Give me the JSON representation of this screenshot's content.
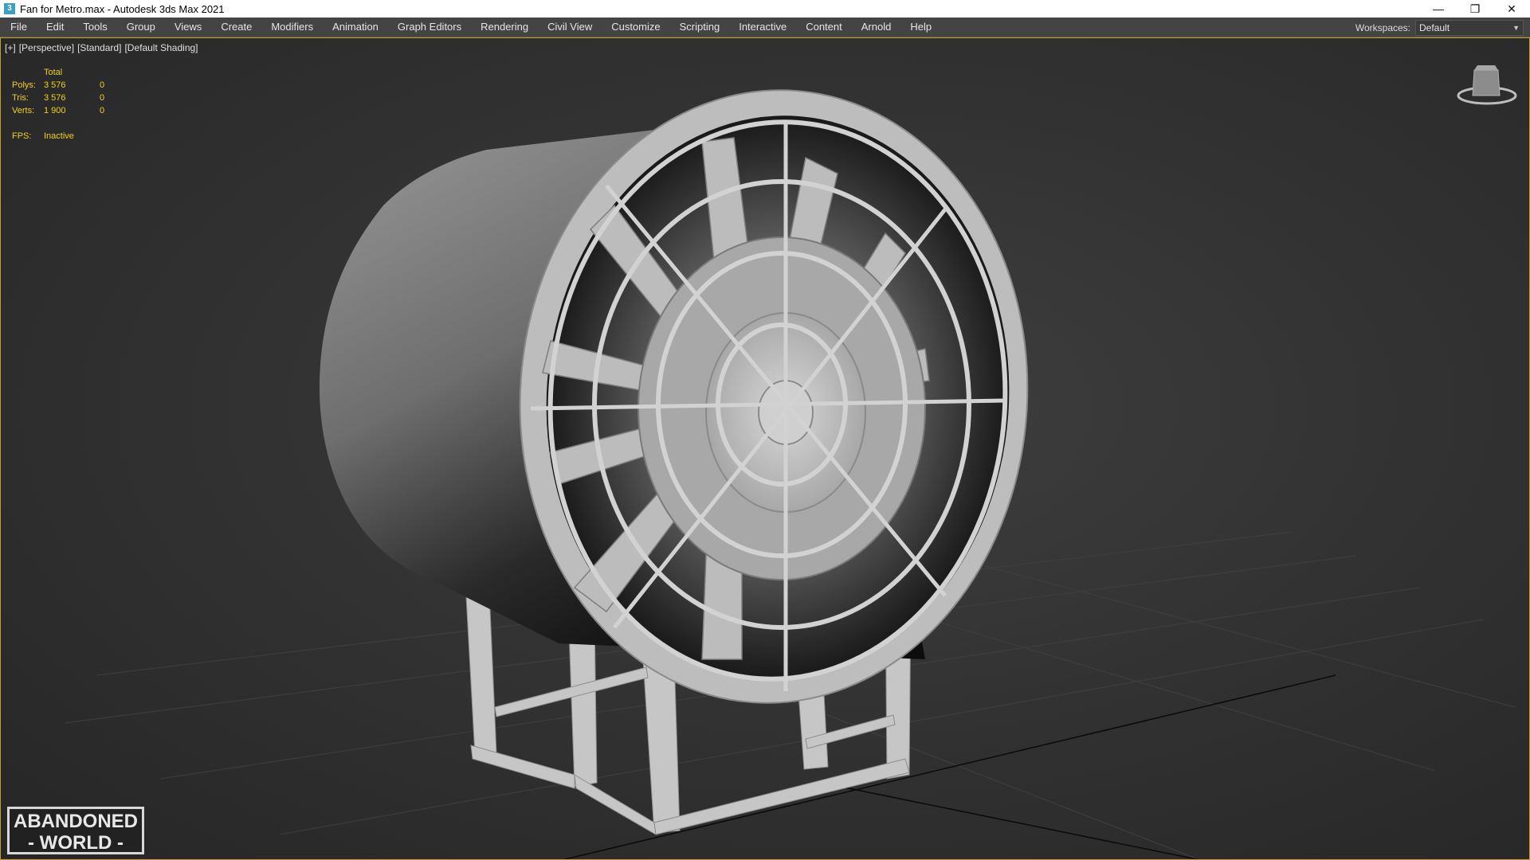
{
  "window": {
    "title": "Fan for Metro.max - Autodesk 3ds Max 2021",
    "app_icon": "3",
    "controls": [
      "minimize-icon",
      "restore-icon",
      "close-icon"
    ]
  },
  "menu": {
    "items": [
      "File",
      "Edit",
      "Tools",
      "Group",
      "Views",
      "Create",
      "Modifiers",
      "Animation",
      "Graph Editors",
      "Rendering",
      "Civil View",
      "Customize",
      "Scripting",
      "Interactive",
      "Content",
      "Arnold",
      "Help"
    ],
    "workspace_label": "Workspaces:",
    "workspace_value": "Default"
  },
  "viewport": {
    "label_plus": "[+]",
    "label_view": "[Perspective]",
    "label_style": "[Standard]",
    "label_shading": "[Default Shading]",
    "stats": {
      "header": "Total",
      "rows": [
        {
          "label": "Polys:",
          "total": "3 576",
          "selected": "0"
        },
        {
          "label": "Tris:",
          "total": "3 576",
          "selected": "0"
        },
        {
          "label": "Verts:",
          "total": "1 900",
          "selected": "0"
        }
      ],
      "fps_label": "FPS:",
      "fps_value": "Inactive"
    },
    "accent_color": "#c8a020",
    "stats_color": "#f0d020",
    "viewcube_icon": "viewcube-icon"
  },
  "watermark": {
    "line1": "ABANDONED",
    "line2": "- WORLD -"
  }
}
